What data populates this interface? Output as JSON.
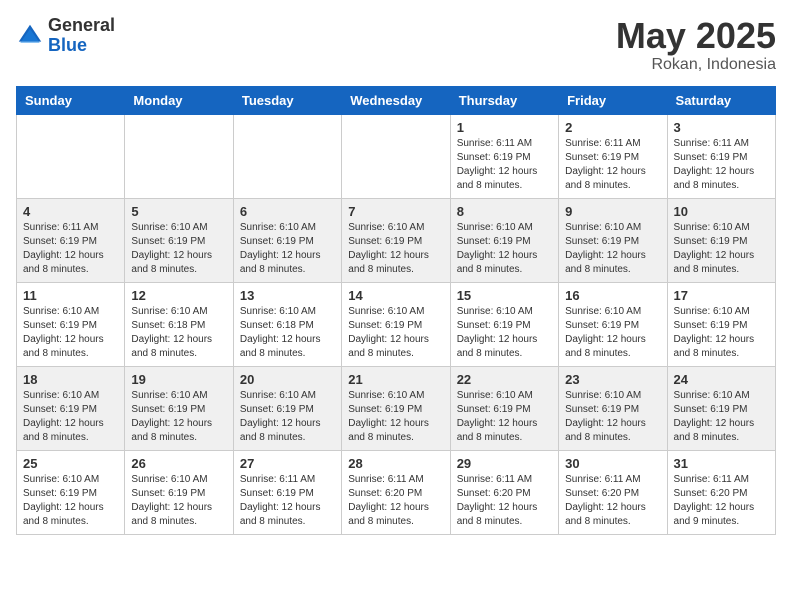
{
  "header": {
    "logo_general": "General",
    "logo_blue": "Blue",
    "month_title": "May 2025",
    "location": "Rokan, Indonesia"
  },
  "days_of_week": [
    "Sunday",
    "Monday",
    "Tuesday",
    "Wednesday",
    "Thursday",
    "Friday",
    "Saturday"
  ],
  "weeks": [
    [
      {
        "num": "",
        "info": ""
      },
      {
        "num": "",
        "info": ""
      },
      {
        "num": "",
        "info": ""
      },
      {
        "num": "",
        "info": ""
      },
      {
        "num": "1",
        "info": "Sunrise: 6:11 AM\nSunset: 6:19 PM\nDaylight: 12 hours and 8 minutes."
      },
      {
        "num": "2",
        "info": "Sunrise: 6:11 AM\nSunset: 6:19 PM\nDaylight: 12 hours and 8 minutes."
      },
      {
        "num": "3",
        "info": "Sunrise: 6:11 AM\nSunset: 6:19 PM\nDaylight: 12 hours and 8 minutes."
      }
    ],
    [
      {
        "num": "4",
        "info": "Sunrise: 6:11 AM\nSunset: 6:19 PM\nDaylight: 12 hours and 8 minutes."
      },
      {
        "num": "5",
        "info": "Sunrise: 6:10 AM\nSunset: 6:19 PM\nDaylight: 12 hours and 8 minutes."
      },
      {
        "num": "6",
        "info": "Sunrise: 6:10 AM\nSunset: 6:19 PM\nDaylight: 12 hours and 8 minutes."
      },
      {
        "num": "7",
        "info": "Sunrise: 6:10 AM\nSunset: 6:19 PM\nDaylight: 12 hours and 8 minutes."
      },
      {
        "num": "8",
        "info": "Sunrise: 6:10 AM\nSunset: 6:19 PM\nDaylight: 12 hours and 8 minutes."
      },
      {
        "num": "9",
        "info": "Sunrise: 6:10 AM\nSunset: 6:19 PM\nDaylight: 12 hours and 8 minutes."
      },
      {
        "num": "10",
        "info": "Sunrise: 6:10 AM\nSunset: 6:19 PM\nDaylight: 12 hours and 8 minutes."
      }
    ],
    [
      {
        "num": "11",
        "info": "Sunrise: 6:10 AM\nSunset: 6:19 PM\nDaylight: 12 hours and 8 minutes."
      },
      {
        "num": "12",
        "info": "Sunrise: 6:10 AM\nSunset: 6:18 PM\nDaylight: 12 hours and 8 minutes."
      },
      {
        "num": "13",
        "info": "Sunrise: 6:10 AM\nSunset: 6:18 PM\nDaylight: 12 hours and 8 minutes."
      },
      {
        "num": "14",
        "info": "Sunrise: 6:10 AM\nSunset: 6:19 PM\nDaylight: 12 hours and 8 minutes."
      },
      {
        "num": "15",
        "info": "Sunrise: 6:10 AM\nSunset: 6:19 PM\nDaylight: 12 hours and 8 minutes."
      },
      {
        "num": "16",
        "info": "Sunrise: 6:10 AM\nSunset: 6:19 PM\nDaylight: 12 hours and 8 minutes."
      },
      {
        "num": "17",
        "info": "Sunrise: 6:10 AM\nSunset: 6:19 PM\nDaylight: 12 hours and 8 minutes."
      }
    ],
    [
      {
        "num": "18",
        "info": "Sunrise: 6:10 AM\nSunset: 6:19 PM\nDaylight: 12 hours and 8 minutes."
      },
      {
        "num": "19",
        "info": "Sunrise: 6:10 AM\nSunset: 6:19 PM\nDaylight: 12 hours and 8 minutes."
      },
      {
        "num": "20",
        "info": "Sunrise: 6:10 AM\nSunset: 6:19 PM\nDaylight: 12 hours and 8 minutes."
      },
      {
        "num": "21",
        "info": "Sunrise: 6:10 AM\nSunset: 6:19 PM\nDaylight: 12 hours and 8 minutes."
      },
      {
        "num": "22",
        "info": "Sunrise: 6:10 AM\nSunset: 6:19 PM\nDaylight: 12 hours and 8 minutes."
      },
      {
        "num": "23",
        "info": "Sunrise: 6:10 AM\nSunset: 6:19 PM\nDaylight: 12 hours and 8 minutes."
      },
      {
        "num": "24",
        "info": "Sunrise: 6:10 AM\nSunset: 6:19 PM\nDaylight: 12 hours and 8 minutes."
      }
    ],
    [
      {
        "num": "25",
        "info": "Sunrise: 6:10 AM\nSunset: 6:19 PM\nDaylight: 12 hours and 8 minutes."
      },
      {
        "num": "26",
        "info": "Sunrise: 6:10 AM\nSunset: 6:19 PM\nDaylight: 12 hours and 8 minutes."
      },
      {
        "num": "27",
        "info": "Sunrise: 6:11 AM\nSunset: 6:19 PM\nDaylight: 12 hours and 8 minutes."
      },
      {
        "num": "28",
        "info": "Sunrise: 6:11 AM\nSunset: 6:20 PM\nDaylight: 12 hours and 8 minutes."
      },
      {
        "num": "29",
        "info": "Sunrise: 6:11 AM\nSunset: 6:20 PM\nDaylight: 12 hours and 8 minutes."
      },
      {
        "num": "30",
        "info": "Sunrise: 6:11 AM\nSunset: 6:20 PM\nDaylight: 12 hours and 8 minutes."
      },
      {
        "num": "31",
        "info": "Sunrise: 6:11 AM\nSunset: 6:20 PM\nDaylight: 12 hours and 9 minutes."
      }
    ]
  ]
}
